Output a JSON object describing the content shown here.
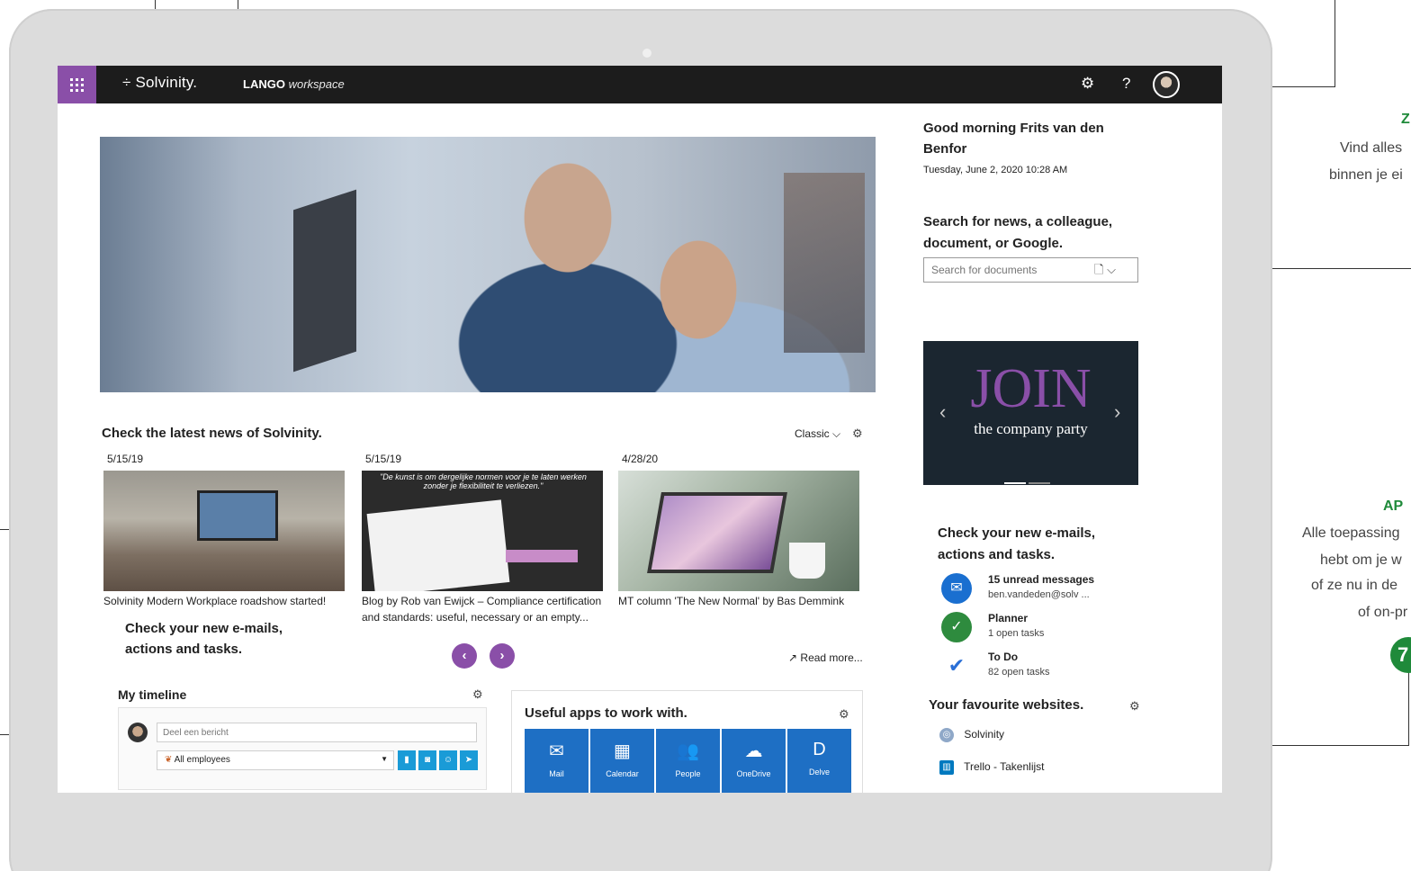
{
  "topbar": {
    "brand": "÷ Solvinity.",
    "workspace_bold": "LANGO",
    "workspace_italic": "workspace",
    "settings_icon": "gear-icon",
    "help_label": "?"
  },
  "news": {
    "heading": "Check the latest news of Solvinity.",
    "view_label": "Classic",
    "read_more": "Read more...",
    "items": [
      {
        "date": "5/15/19",
        "caption": "Solvinity Modern Workplace roadshow started!"
      },
      {
        "date": "5/15/19",
        "caption": "Blog by Rob van Ewijck – Compliance certification and standards: useful, necessary or an empty...",
        "thumb_quote": "\"De kunst is om dergelijke normen voor je te laten werken zonder je flexibiliteit te verliezen.\""
      },
      {
        "date": "4/28/20",
        "caption": "MT column 'The New Normal' by Bas Demmink"
      }
    ]
  },
  "left_heading": "Check your new e-mails, actions and tasks.",
  "timeline": {
    "title": "My timeline",
    "post_placeholder": "Deel een bericht",
    "audience": "All employees"
  },
  "apps": {
    "title": "Useful apps to work with.",
    "tiles": [
      "Mail",
      "Calendar",
      "People",
      "OneDrive",
      "Delve"
    ]
  },
  "greeting": {
    "text": "Good morning Frits van den Benfor",
    "date": "Tuesday, June 2, 2020 10:28 AM"
  },
  "search": {
    "heading": "Search for news, a colleague, document, or Google.",
    "placeholder": "Search for documents"
  },
  "banner": {
    "big": "JOIN",
    "sub": "the company party"
  },
  "mail": {
    "heading": "Check your new e-mails, actions and tasks.",
    "rows": [
      {
        "title": "15 unread messages",
        "sub": "ben.vandeden@solv ...",
        "color": "#1a6fd0"
      },
      {
        "title": "Planner",
        "sub": "1 open tasks",
        "color": "#2e8b3e"
      },
      {
        "title": "To Do",
        "sub": "82 open tasks",
        "color": "#2a6fd6"
      }
    ]
  },
  "favourites": {
    "heading": "Your favourite websites.",
    "items": [
      "Solvinity",
      "Trello - Takenlijst"
    ]
  },
  "annotations": {
    "z_label": "Z",
    "z_line1": "Vind alles",
    "z_line2": "binnen je ei",
    "ap_label": "AP",
    "ap_line1": "Alle toepassing",
    "ap_line2": "hebt om je w",
    "ap_line3": "of ze nu in de",
    "ap_line4": "of on-pr",
    "badge": "7"
  },
  "colors": {
    "accent": "#8a4fa8",
    "topbar": "#1c1c1c",
    "tile": "#1e6fc4",
    "annotation_green": "#1f8a3a"
  }
}
